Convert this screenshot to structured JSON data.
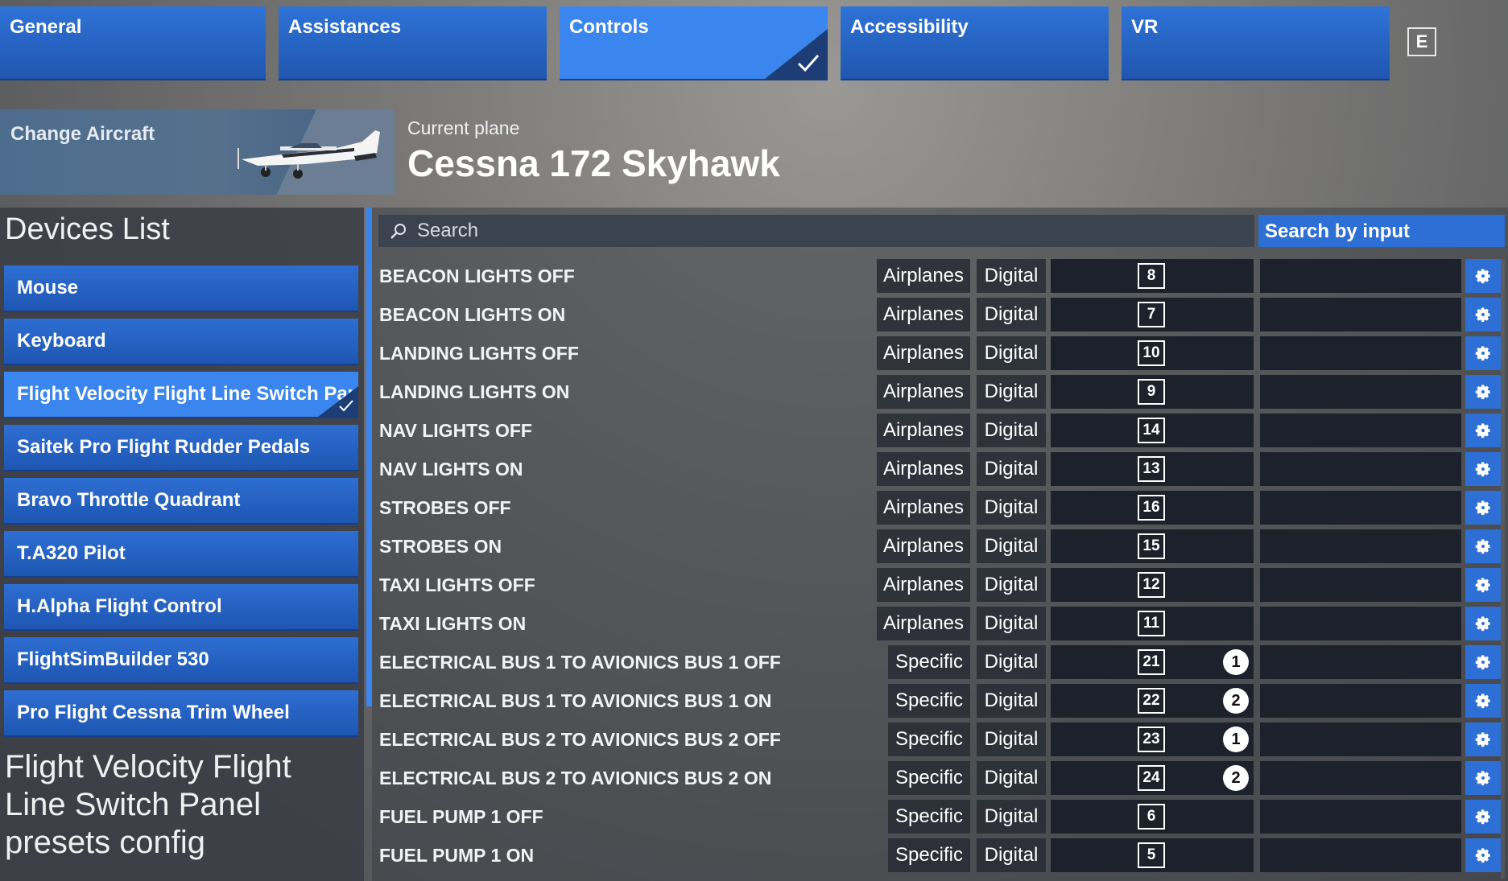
{
  "tabs": [
    {
      "label": "General",
      "active": false
    },
    {
      "label": "Assistances",
      "active": false
    },
    {
      "label": "Controls",
      "active": true
    },
    {
      "label": "Accessibility",
      "active": false
    },
    {
      "label": "VR",
      "active": false
    }
  ],
  "key_hint": "E",
  "aircraft": {
    "change_label": "Change Aircraft",
    "current_label": "Current plane",
    "name": "Cessna 172 Skyhawk"
  },
  "devices": {
    "title": "Devices List",
    "items": [
      {
        "label": "Mouse"
      },
      {
        "label": "Keyboard"
      },
      {
        "label": "Flight Velocity Flight Line Switch Panel",
        "active": true
      },
      {
        "label": "Saitek Pro Flight Rudder Pedals"
      },
      {
        "label": "Bravo Throttle Quadrant"
      },
      {
        "label": "T.A320 Pilot"
      },
      {
        "label": "H.Alpha Flight Control"
      },
      {
        "label": "FlightSimBuilder 530"
      },
      {
        "label": "Pro Flight Cessna Trim Wheel"
      }
    ],
    "preset_title": "Flight Velocity Flight Line Switch Panel presets config"
  },
  "search": {
    "placeholder": "Search",
    "by_input_label": "Search by input"
  },
  "bindings": [
    {
      "name": "BEACON LIGHTS OFF",
      "category": "Airplanes",
      "type": "Digital",
      "button": "8",
      "index": ""
    },
    {
      "name": "BEACON LIGHTS ON",
      "category": "Airplanes",
      "type": "Digital",
      "button": "7",
      "index": ""
    },
    {
      "name": "LANDING LIGHTS OFF",
      "category": "Airplanes",
      "type": "Digital",
      "button": "10",
      "index": ""
    },
    {
      "name": "LANDING LIGHTS ON",
      "category": "Airplanes",
      "type": "Digital",
      "button": "9",
      "index": ""
    },
    {
      "name": "NAV LIGHTS OFF",
      "category": "Airplanes",
      "type": "Digital",
      "button": "14",
      "index": ""
    },
    {
      "name": "NAV LIGHTS ON",
      "category": "Airplanes",
      "type": "Digital",
      "button": "13",
      "index": ""
    },
    {
      "name": "STROBES OFF",
      "category": "Airplanes",
      "type": "Digital",
      "button": "16",
      "index": ""
    },
    {
      "name": "STROBES ON",
      "category": "Airplanes",
      "type": "Digital",
      "button": "15",
      "index": ""
    },
    {
      "name": "TAXI LIGHTS OFF",
      "category": "Airplanes",
      "type": "Digital",
      "button": "12",
      "index": ""
    },
    {
      "name": "TAXI LIGHTS ON",
      "category": "Airplanes",
      "type": "Digital",
      "button": "11",
      "index": ""
    },
    {
      "name": "ELECTRICAL BUS 1 TO AVIONICS BUS 1 OFF",
      "category": "Specific",
      "type": "Digital",
      "button": "21",
      "index": "1"
    },
    {
      "name": "ELECTRICAL BUS 1 TO AVIONICS BUS 1 ON",
      "category": "Specific",
      "type": "Digital",
      "button": "22",
      "index": "2"
    },
    {
      "name": "ELECTRICAL BUS 2 TO AVIONICS BUS 2 OFF",
      "category": "Specific",
      "type": "Digital",
      "button": "23",
      "index": "1"
    },
    {
      "name": "ELECTRICAL BUS 2 TO AVIONICS BUS 2 ON",
      "category": "Specific",
      "type": "Digital",
      "button": "24",
      "index": "2"
    },
    {
      "name": "FUEL PUMP 1 OFF",
      "category": "Specific",
      "type": "Digital",
      "button": "6",
      "index": ""
    },
    {
      "name": "FUEL PUMP 1 ON",
      "category": "Specific",
      "type": "Digital",
      "button": "5",
      "index": ""
    }
  ],
  "icons": {
    "settings": "gear-icon",
    "search": "search-icon",
    "selected": "checkmark-icon"
  },
  "colors": {
    "accent": "#3a86ee",
    "tab": "#1f56b0",
    "binding_slot": "#1c212b"
  }
}
